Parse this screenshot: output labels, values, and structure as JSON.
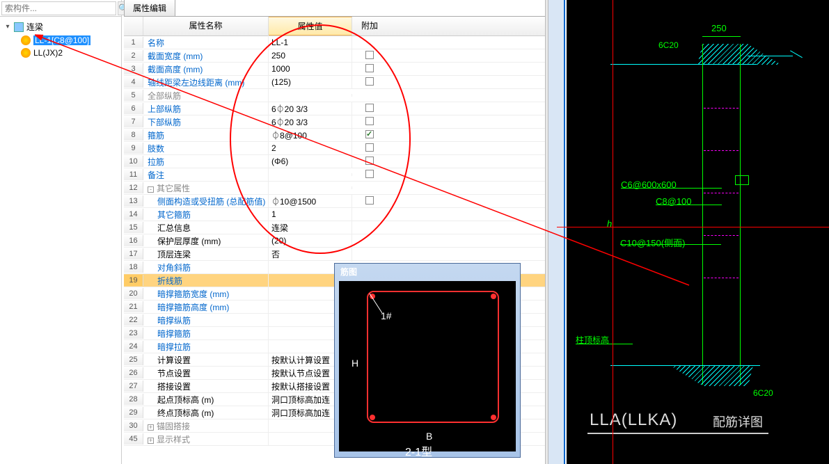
{
  "search": {
    "placeholder": "索构件..."
  },
  "tree": {
    "root": {
      "label": "连梁"
    },
    "items": [
      {
        "label": "LL-1[C8@100]"
      },
      {
        "label": "LL(JX)2"
      }
    ]
  },
  "tab": {
    "label": "属性编辑"
  },
  "headers": {
    "name": "属性名称",
    "value": "属性值",
    "add": "附加"
  },
  "rows": [
    {
      "n": "1",
      "name": "名称",
      "val": "LL-1",
      "cls": "blue"
    },
    {
      "n": "2",
      "name": "截面宽度 (mm)",
      "val": "250",
      "cls": "blue"
    },
    {
      "n": "3",
      "name": "截面高度 (mm)",
      "val": "1000",
      "cls": "blue"
    },
    {
      "n": "4",
      "name": "轴线距梁左边线距离 (mm)",
      "val": "(125)",
      "cls": "blue"
    },
    {
      "n": "5",
      "name": "全部纵筋",
      "val": "",
      "cls": "gray"
    },
    {
      "n": "6",
      "name": "上部纵筋",
      "val": "6⏀20 3/3",
      "cls": "blue"
    },
    {
      "n": "7",
      "name": "下部纵筋",
      "val": "6⏀20 3/3",
      "cls": "blue"
    },
    {
      "n": "8",
      "name": "箍筋",
      "val": "⏀8@100",
      "cls": "blue",
      "checked": true
    },
    {
      "n": "9",
      "name": "肢数",
      "val": "2",
      "cls": "blue"
    },
    {
      "n": "10",
      "name": "拉筋",
      "val": "(Φ6)",
      "cls": "blue"
    },
    {
      "n": "11",
      "name": "备注",
      "val": "",
      "cls": "blue"
    },
    {
      "n": "12",
      "name": "其它属性",
      "val": "",
      "cls": "gray",
      "expand": "-"
    },
    {
      "n": "13",
      "name": "侧面构造或受扭筋 (总配筋值)",
      "val": "⏀10@1500",
      "cls": "blue",
      "indent": true
    },
    {
      "n": "14",
      "name": "其它箍筋",
      "val": "1",
      "cls": "blue",
      "indent": true
    },
    {
      "n": "15",
      "name": "汇总信息",
      "val": "连梁",
      "cls": "",
      "indent": true
    },
    {
      "n": "16",
      "name": "保护层厚度 (mm)",
      "val": "(20)",
      "cls": "",
      "indent": true
    },
    {
      "n": "17",
      "name": "顶层连梁",
      "val": "否",
      "cls": "",
      "indent": true
    },
    {
      "n": "18",
      "name": "对角斜筋",
      "val": "",
      "cls": "blue",
      "indent": true
    },
    {
      "n": "19",
      "name": "折线筋",
      "val": "",
      "cls": "blue",
      "indent": true,
      "selected": true
    },
    {
      "n": "20",
      "name": "暗撑箍筋宽度 (mm)",
      "val": "",
      "cls": "blue",
      "indent": true
    },
    {
      "n": "21",
      "name": "暗撑箍筋高度 (mm)",
      "val": "",
      "cls": "blue",
      "indent": true
    },
    {
      "n": "22",
      "name": "暗撑纵筋",
      "val": "",
      "cls": "blue",
      "indent": true
    },
    {
      "n": "23",
      "name": "暗撑箍筋",
      "val": "",
      "cls": "blue",
      "indent": true
    },
    {
      "n": "24",
      "name": "暗撑拉筋",
      "val": "",
      "cls": "blue",
      "indent": true
    },
    {
      "n": "25",
      "name": "计算设置",
      "val": "按默认计算设置",
      "cls": "",
      "indent": true
    },
    {
      "n": "26",
      "name": "节点设置",
      "val": "按默认节点设置",
      "cls": "",
      "indent": true
    },
    {
      "n": "27",
      "name": "搭接设置",
      "val": "按默认搭接设置",
      "cls": "",
      "indent": true
    },
    {
      "n": "28",
      "name": "起点顶标高 (m)",
      "val": "洞口顶标高加连",
      "cls": "",
      "indent": true
    },
    {
      "n": "29",
      "name": "终点顶标高 (m)",
      "val": "洞口顶标高加连",
      "cls": "",
      "indent": true
    },
    {
      "n": "30",
      "name": "锚固搭接",
      "val": "",
      "cls": "gray",
      "expand": "+"
    },
    {
      "n": "45",
      "name": "显示样式",
      "val": "",
      "cls": "gray",
      "expand": "+"
    }
  ],
  "rebar": {
    "title": "筋图",
    "label1": "1#",
    "labelH": "H",
    "labelB": "B",
    "labelType": "2-1型"
  },
  "cad": {
    "dim250": "250",
    "top6c20": "6C20",
    "bot6c20": "6C20",
    "text1": "C6@600x600",
    "text2": "C8@100",
    "text3": "C10@150(侧面)",
    "hlabel": "h",
    "botgreen": "柱顶标高",
    "title": "LLA(LLKA)",
    "subtitle": "配筋详图"
  }
}
